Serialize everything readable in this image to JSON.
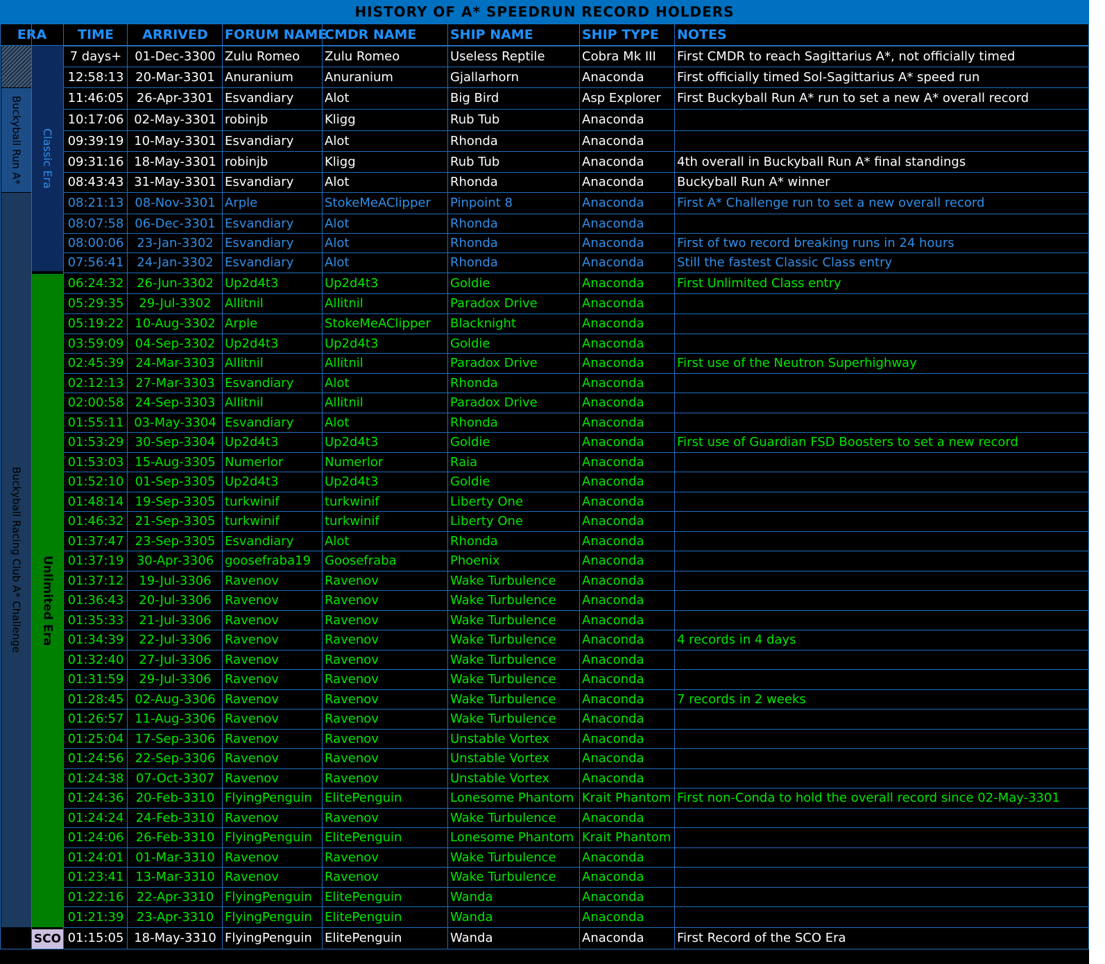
{
  "title": "HISTORY OF A* SPEEDRUN RECORD HOLDERS",
  "headers": [
    "ERA",
    "TIME",
    "ARRIVED",
    "FORUM NAME",
    "CMDR NAME",
    "SHIP NAME",
    "SHIP TYPE",
    "NOTES"
  ],
  "side_labels": {
    "buckyball_run": "Buckyball Run A*",
    "brc_challenge": "Buckyball Racing Club A* Challenge",
    "classic_era": "Classic Era",
    "unlimited_era": "Unlimited Era",
    "sco": "SCO"
  },
  "colors": {
    "background": "#000000",
    "title_bar": "#0070c0",
    "header_text": "#1e90ff",
    "grid": "#1f6fbf",
    "white_row_text": "#ffffff",
    "blue_row_text": "#2f8fe8",
    "green_row_text": "#00e600",
    "classic_era_fill": "#0d2a5e",
    "unlimited_era_fill": "#008000",
    "buckyball_fill": "#1c4d86",
    "brc_fill": "#1c3a5e",
    "sco_fill": "#ccc0e0"
  },
  "rows": [
    {
      "time": "7 days+",
      "arrived": "01-Dec-3300",
      "forum": "Zulu Romeo",
      "cmdr": "Zulu Romeo",
      "ship": "Useless Reptile",
      "type": "Cobra Mk III",
      "notes": "First CMDR to reach Sagittarius A*, not officially timed",
      "style": "white"
    },
    {
      "time": "12:58:13",
      "arrived": "20-Mar-3301",
      "forum": "Anuranium",
      "cmdr": "Anuranium",
      "ship": "Gjallarhorn",
      "type": "Anaconda",
      "notes": "First officially timed Sol-Sagittarius A* speed run",
      "style": "white"
    },
    {
      "time": "11:46:05",
      "arrived": "26-Apr-3301",
      "forum": "Esvandiary",
      "cmdr": "Alot",
      "ship": "Big Bird",
      "type": "Asp Explorer",
      "notes": "First Buckyball Run A* run to set a new A* overall record",
      "style": "white"
    },
    {
      "time": "10:17:06",
      "arrived": "02-May-3301",
      "forum": "robinjb",
      "cmdr": "Kligg",
      "ship": "Rub Tub",
      "type": "Anaconda",
      "notes": "",
      "style": "white"
    },
    {
      "time": "09:39:19",
      "arrived": "10-May-3301",
      "forum": "Esvandiary",
      "cmdr": "Alot",
      "ship": "Rhonda",
      "type": "Anaconda",
      "notes": "",
      "style": "white"
    },
    {
      "time": "09:31:16",
      "arrived": "18-May-3301",
      "forum": "robinjb",
      "cmdr": "Kligg",
      "ship": "Rub Tub",
      "type": "Anaconda",
      "notes": "4th overall in Buckyball Run A* final standings",
      "style": "white"
    },
    {
      "time": "08:43:43",
      "arrived": "31-May-3301",
      "forum": "Esvandiary",
      "cmdr": "Alot",
      "ship": "Rhonda",
      "type": "Anaconda",
      "notes": "Buckyball Run A* winner",
      "style": "white"
    },
    {
      "time": "08:21:13",
      "arrived": "08-Nov-3301",
      "forum": "Arple",
      "cmdr": "StokeMeAClipper",
      "ship": "Pinpoint 8",
      "type": "Anaconda",
      "notes": "First A* Challenge run to set a new overall record",
      "style": "blue"
    },
    {
      "time": "08:07:58",
      "arrived": "06-Dec-3301",
      "forum": "Esvandiary",
      "cmdr": "Alot",
      "ship": "Rhonda",
      "type": "Anaconda",
      "notes": "",
      "style": "blue"
    },
    {
      "time": "08:00:06",
      "arrived": "23-Jan-3302",
      "forum": "Esvandiary",
      "cmdr": "Alot",
      "ship": "Rhonda",
      "type": "Anaconda",
      "notes": "First of two record breaking runs in 24 hours",
      "style": "blue"
    },
    {
      "time": "07:56:41",
      "arrived": "24-Jan-3302",
      "forum": "Esvandiary",
      "cmdr": "Alot",
      "ship": "Rhonda",
      "type": "Anaconda",
      "notes": "Still the fastest Classic Class entry",
      "style": "blue"
    },
    {
      "time": "06:24:32",
      "arrived": "26-Jun-3302",
      "forum": "Up2d4t3",
      "cmdr": "Up2d4t3",
      "ship": "Goldie",
      "type": "Anaconda",
      "notes": "First Unlimited Class entry",
      "style": "green"
    },
    {
      "time": "05:29:35",
      "arrived": "29-Jul-3302",
      "forum": "Allitnil",
      "cmdr": "Allitnil",
      "ship": "Paradox Drive",
      "type": "Anaconda",
      "notes": "",
      "style": "green"
    },
    {
      "time": "05:19:22",
      "arrived": "10-Aug-3302",
      "forum": "Arple",
      "cmdr": "StokeMeAClipper",
      "ship": "Blacknight",
      "type": "Anaconda",
      "notes": "",
      "style": "green"
    },
    {
      "time": "03:59:09",
      "arrived": "04-Sep-3302",
      "forum": "Up2d4t3",
      "cmdr": "Up2d4t3",
      "ship": "Goldie",
      "type": "Anaconda",
      "notes": "",
      "style": "green"
    },
    {
      "time": "02:45:39",
      "arrived": "24-Mar-3303",
      "forum": "Allitnil",
      "cmdr": "Allitnil",
      "ship": "Paradox Drive",
      "type": "Anaconda",
      "notes": "First use of the Neutron Superhighway",
      "style": "green"
    },
    {
      "time": "02:12:13",
      "arrived": "27-Mar-3303",
      "forum": "Esvandiary",
      "cmdr": "Alot",
      "ship": "Rhonda",
      "type": "Anaconda",
      "notes": "",
      "style": "green"
    },
    {
      "time": "02:00:58",
      "arrived": "24-Sep-3303",
      "forum": "Allitnil",
      "cmdr": "Allitnil",
      "ship": "Paradox Drive",
      "type": "Anaconda",
      "notes": "",
      "style": "green"
    },
    {
      "time": "01:55:11",
      "arrived": "03-May-3304",
      "forum": "Esvandiary",
      "cmdr": "Alot",
      "ship": "Rhonda",
      "type": "Anaconda",
      "notes": "",
      "style": "green"
    },
    {
      "time": "01:53:29",
      "arrived": "30-Sep-3304",
      "forum": "Up2d4t3",
      "cmdr": "Up2d4t3",
      "ship": "Goldie",
      "type": "Anaconda",
      "notes": "First use of Guardian FSD Boosters to set a new record",
      "style": "green"
    },
    {
      "time": "01:53:03",
      "arrived": "15-Aug-3305",
      "forum": "Numerlor",
      "cmdr": "Numerlor",
      "ship": "Raia",
      "type": "Anaconda",
      "notes": "",
      "style": "green"
    },
    {
      "time": "01:52:10",
      "arrived": "01-Sep-3305",
      "forum": "Up2d4t3",
      "cmdr": "Up2d4t3",
      "ship": "Goldie",
      "type": "Anaconda",
      "notes": "",
      "style": "green"
    },
    {
      "time": "01:48:14",
      "arrived": "19-Sep-3305",
      "forum": "turkwinif",
      "cmdr": "turkwinif",
      "ship": "Liberty One",
      "type": "Anaconda",
      "notes": "",
      "style": "green"
    },
    {
      "time": "01:46:32",
      "arrived": "21-Sep-3305",
      "forum": "turkwinif",
      "cmdr": "turkwinif",
      "ship": "Liberty One",
      "type": "Anaconda",
      "notes": "",
      "style": "green"
    },
    {
      "time": "01:37:47",
      "arrived": "23-Sep-3305",
      "forum": "Esvandiary",
      "cmdr": "Alot",
      "ship": "Rhonda",
      "type": "Anaconda",
      "notes": "",
      "style": "green"
    },
    {
      "time": "01:37:19",
      "arrived": "30-Apr-3306",
      "forum": "goosefraba19",
      "cmdr": "Goosefraba",
      "ship": "Phoenix",
      "type": "Anaconda",
      "notes": "",
      "style": "green"
    },
    {
      "time": "01:37:12",
      "arrived": "19-Jul-3306",
      "forum": "Ravenov",
      "cmdr": "Ravenov",
      "ship": "Wake Turbulence",
      "type": "Anaconda",
      "notes": "",
      "style": "green"
    },
    {
      "time": "01:36:43",
      "arrived": "20-Jul-3306",
      "forum": "Ravenov",
      "cmdr": "Ravenov",
      "ship": "Wake Turbulence",
      "type": "Anaconda",
      "notes": "",
      "style": "green"
    },
    {
      "time": "01:35:33",
      "arrived": "21-Jul-3306",
      "forum": "Ravenov",
      "cmdr": "Ravenov",
      "ship": "Wake Turbulence",
      "type": "Anaconda",
      "notes": "",
      "style": "green"
    },
    {
      "time": "01:34:39",
      "arrived": "22-Jul-3306",
      "forum": "Ravenov",
      "cmdr": "Ravenov",
      "ship": "Wake Turbulence",
      "type": "Anaconda",
      "notes": "4 records in 4 days",
      "style": "green"
    },
    {
      "time": "01:32:40",
      "arrived": "27-Jul-3306",
      "forum": "Ravenov",
      "cmdr": "Ravenov",
      "ship": "Wake Turbulence",
      "type": "Anaconda",
      "notes": "",
      "style": "green"
    },
    {
      "time": "01:31:59",
      "arrived": "29-Jul-3306",
      "forum": "Ravenov",
      "cmdr": "Ravenov",
      "ship": "Wake Turbulence",
      "type": "Anaconda",
      "notes": "",
      "style": "green"
    },
    {
      "time": "01:28:45",
      "arrived": "02-Aug-3306",
      "forum": "Ravenov",
      "cmdr": "Ravenov",
      "ship": "Wake Turbulence",
      "type": "Anaconda",
      "notes": "7 records in 2 weeks",
      "style": "green"
    },
    {
      "time": "01:26:57",
      "arrived": "11-Aug-3306",
      "forum": "Ravenov",
      "cmdr": "Ravenov",
      "ship": "Wake Turbulence",
      "type": "Anaconda",
      "notes": "",
      "style": "green"
    },
    {
      "time": "01:25:04",
      "arrived": "17-Sep-3306",
      "forum": "Ravenov",
      "cmdr": "Ravenov",
      "ship": "Unstable Vortex",
      "type": "Anaconda",
      "notes": "",
      "style": "green"
    },
    {
      "time": "01:24:56",
      "arrived": "22-Sep-3306",
      "forum": "Ravenov",
      "cmdr": "Ravenov",
      "ship": "Unstable Vortex",
      "type": "Anaconda",
      "notes": "",
      "style": "green"
    },
    {
      "time": "01:24:38",
      "arrived": "07-Oct-3307",
      "forum": "Ravenov",
      "cmdr": "Ravenov",
      "ship": "Unstable Vortex",
      "type": "Anaconda",
      "notes": "",
      "style": "green"
    },
    {
      "time": "01:24:36",
      "arrived": "20-Feb-3310",
      "forum": "FlyingPenguin",
      "cmdr": "ElitePenguin",
      "ship": "Lonesome Phantom",
      "type": "Krait Phantom",
      "notes": "First non-Conda to hold the overall record since 02-May-3301",
      "style": "green"
    },
    {
      "time": "01:24:24",
      "arrived": "24-Feb-3310",
      "forum": "Ravenov",
      "cmdr": "Ravenov",
      "ship": "Wake Turbulence",
      "type": "Anaconda",
      "notes": "",
      "style": "green"
    },
    {
      "time": "01:24:06",
      "arrived": "26-Feb-3310",
      "forum": "FlyingPenguin",
      "cmdr": "ElitePenguin",
      "ship": "Lonesome Phantom",
      "type": "Krait Phantom",
      "notes": "",
      "style": "green"
    },
    {
      "time": "01:24:01",
      "arrived": "01-Mar-3310",
      "forum": "Ravenov",
      "cmdr": "Ravenov",
      "ship": "Wake Turbulence",
      "type": "Anaconda",
      "notes": "",
      "style": "green"
    },
    {
      "time": "01:23:41",
      "arrived": "13-Mar-3310",
      "forum": "Ravenov",
      "cmdr": "Ravenov",
      "ship": "Wake Turbulence",
      "type": "Anaconda",
      "notes": "",
      "style": "green"
    },
    {
      "time": "01:22:16",
      "arrived": "22-Apr-3310",
      "forum": "FlyingPenguin",
      "cmdr": "ElitePenguin",
      "ship": "Wanda",
      "type": "Anaconda",
      "notes": "",
      "style": "green"
    },
    {
      "time": "01:21:39",
      "arrived": "23-Apr-3310",
      "forum": "FlyingPenguin",
      "cmdr": "ElitePenguin",
      "ship": "Wanda",
      "type": "Anaconda",
      "notes": "",
      "style": "green"
    },
    {
      "time": "01:15:05",
      "arrived": "18-May-3310",
      "forum": "FlyingPenguin",
      "cmdr": "ElitePenguin",
      "ship": "Wanda",
      "type": "Anaconda",
      "notes": "First Record of the SCO Era",
      "style": "white"
    }
  ]
}
